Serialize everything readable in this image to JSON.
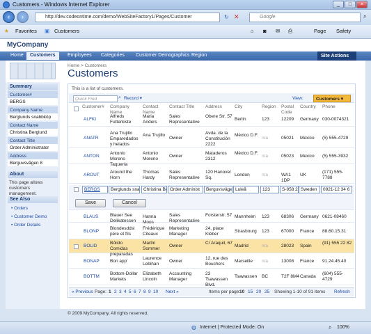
{
  "window": {
    "title": "Customers - Windows Internet Explorer"
  },
  "browser": {
    "url": "http://dev.codeontime.com/demo/WebSiteFactory1/Pages/Customer",
    "search_placeholder": "Google",
    "favorites": "Favorites",
    "tab": "Customers",
    "page_menu": "Page",
    "safety_menu": "Safety"
  },
  "app": {
    "logo": "MyCompany"
  },
  "menu": [
    "Home",
    "Customers",
    "Employees",
    "Categories",
    "Customer Demographics",
    "Region"
  ],
  "site_actions": "Site Actions",
  "breadcrumb": "Home > Customers",
  "page_title": "Customers",
  "sidebar": {
    "summary_title": "Summary",
    "fields": [
      {
        "label": "Customer#",
        "value": "BERGS"
      },
      {
        "label": "Company Name",
        "value": "Berglunds snabbköp"
      },
      {
        "label": "Contact Name",
        "value": "Christina Berglund"
      },
      {
        "label": "Contact Title",
        "value": "Order Administrator"
      },
      {
        "label": "Address",
        "value": "Berguvsvägen 8"
      }
    ],
    "about_title": "About",
    "about_text": "This page allows customers management.",
    "see_also_title": "See Also",
    "links": [
      "Orders",
      "Customer Demo",
      "Order Details"
    ]
  },
  "grid": {
    "description": "This is a list of customers.",
    "quick_find": "Quick Find",
    "record_label": "Record",
    "view_label": "View:",
    "view_value": "Customers",
    "headers": [
      "Customer#",
      "Company Name",
      "Contact Name",
      "Contact Title",
      "Address",
      "City",
      "Region",
      "Postal Code",
      "Country",
      "Phone"
    ],
    "rows_top": [
      [
        "ALFKI",
        "Alfreds Futterkiste",
        "Maria Anders",
        "Sales Representative",
        "Obere Str. 57",
        "Berlin",
        "123",
        "12209",
        "Germany",
        "030-0074321"
      ],
      [
        "ANATR",
        "Ana Trujillo Emparedados y helados",
        "Ana Trujillo",
        "Owner",
        "Avda. de la Constitución 2222",
        "México D.F.",
        "n/a",
        "05021",
        "Mexico",
        "(5) 555-4729"
      ],
      [
        "ANTON",
        "Antonio Moreno Taquería",
        "Antonio Moreno",
        "Owner",
        "Mataderos 2312",
        "México D.F.",
        "n/a",
        "05023",
        "Mexico",
        "(5) 555-3932"
      ],
      [
        "AROUT",
        "Around the Horn",
        "Thomas Hardy",
        "Sales Representative",
        "120 Hanover Sq.",
        "London",
        "n/a",
        "WA1 1DP",
        "UK",
        "(171) 555-7788"
      ]
    ],
    "edit_row": [
      "BERGS",
      "Berglunds snal",
      "Christina Be",
      "Order Administ",
      "Berguvsväge",
      "Luleå",
      "123",
      "S-958 2",
      "Sweden",
      "0921-12 34 6"
    ],
    "save_label": "Save",
    "cancel_label": "Cancel",
    "rows_bottom": [
      [
        "BLAUS",
        "Blauer See Delikatessen",
        "Hanna Moos",
        "Sales Representative",
        "Forsterstr. 57",
        "Mannheim",
        "123",
        "68306",
        "Germany",
        "0621-08460"
      ],
      [
        "BLONP",
        "Blondesddsl père et fils",
        "Frédérique Citeaux",
        "Marketing Manager",
        "24, place Kléber",
        "Strasbourg",
        "123",
        "67000",
        "France",
        "88.60.15.31"
      ],
      [
        "BOLID",
        "Bólido Comidas preparadas",
        "Martín Sommer",
        "Owner",
        "C/ Araquil, 67",
        "Madrid",
        "n/a",
        "28023",
        "Spain",
        "(91) 555 22 82"
      ],
      [
        "BONAP",
        "Bon app'",
        "Laurence Lebihan",
        "Owner",
        "12, rue des Bouchers",
        "Marseille",
        "n/a",
        "13008",
        "France",
        "91.24.45.40"
      ],
      [
        "BOTTM",
        "Bottom-Dollar Markets",
        "Elizabeth Lincoln",
        "Accounting Manager",
        "23 Tsawassen Blvd.",
        "Tsawassen",
        "BC",
        "T2F 8M4",
        "Canada",
        "(604) 555-4729"
      ]
    ],
    "pager": {
      "prev": "« Previous",
      "page_label": "Page:",
      "pages": [
        "1",
        "2",
        "3",
        "4",
        "5",
        "6",
        "7",
        "8",
        "9",
        "10"
      ],
      "next": "Next »",
      "per_page_label": "Items per page:",
      "per_page": [
        "10",
        "15",
        "20",
        "25"
      ],
      "showing": "Showing 1-10 of 91 items",
      "refresh": "Refresh"
    }
  },
  "footer": "© 2009 MyCompany. All rights reserved.",
  "status": {
    "zone": "Internet | Protected Mode: On",
    "zoom": "100%"
  }
}
